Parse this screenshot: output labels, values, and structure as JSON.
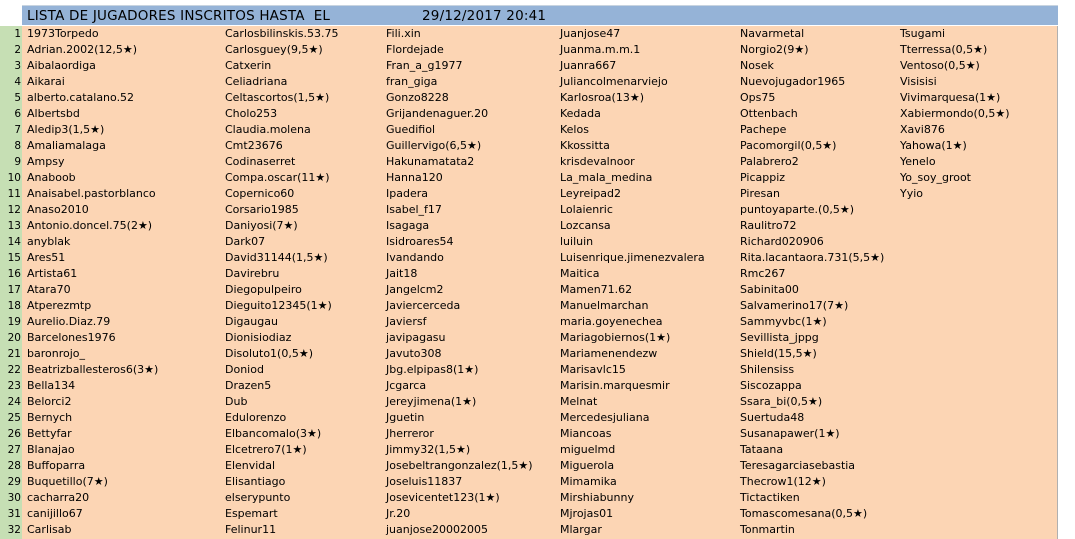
{
  "header": {
    "title": "LISTA DE JUGADORES INSCRITOS HASTA  EL",
    "date": "29/12/2017 20:41"
  },
  "row_numbers": [
    "1",
    "2",
    "3",
    "4",
    "5",
    "6",
    "7",
    "8",
    "9",
    "10",
    "11",
    "12",
    "13",
    "14",
    "15",
    "16",
    "17",
    "18",
    "19",
    "20",
    "21",
    "22",
    "23",
    "24",
    "25",
    "26",
    "27",
    "28",
    "29",
    "30",
    "31",
    "32"
  ],
  "columns": [
    [
      "1973Torpedo",
      "Adrian.2002(12,5★)",
      "Aibalaordiga",
      "Aikarai",
      "alberto.catalano.52",
      "Albertsbd",
      "Aledip3(1,5★)",
      "Amaliamalaga",
      "Ampsy",
      "Anaboob",
      "Anaisabel.pastorblanco",
      "Anaso2010",
      "Antonio.doncel.75(2★)",
      "anyblak",
      "Ares51",
      "Artista61",
      "Atara70",
      "Atperezmtp",
      "Aurelio.Diaz.79",
      "Barcelones1976",
      "baronrojo_",
      "Beatrizballesteros6(3★)",
      "Bella134",
      "Belorci2",
      "Bernych",
      "Bettyfar",
      "Blanajao",
      "Buffoparra",
      "Buquetillo(7★)",
      "cacharra20",
      "canijillo67",
      "Carlisab"
    ],
    [
      "Carlosbilinskis.53.75",
      "Carlosguey(9,5★)",
      "Catxerin",
      "Celiadriana",
      "Celtascortos(1,5★)",
      "Cholo253",
      "Claudia.molena",
      "Cmt23676",
      "Codinaserret",
      "Compa.oscar(11★)",
      "Copernico60",
      "Corsario1985",
      "Daniyosi(7★)",
      "Dark07",
      "David31144(1,5★)",
      "Davirebru",
      "Diegopulpeiro",
      "Dieguito12345(1★)",
      "Digaugau",
      "Dionisiodiaz",
      "Disoluto1(0,5★)",
      "Doniod",
      "Drazen5",
      "Dub",
      "Edulorenzo",
      "Elbancomalo(3★)",
      "Elcetrero7(1★)",
      "Elenvidal",
      "Elisantiago",
      "elserypunto",
      "Espemart",
      "Felinur11"
    ],
    [
      "Fili.xin",
      "Flordejade",
      "Fran_a_g1977",
      "fran_giga",
      "Gonzo8228",
      "Grijandenaguer.20",
      "Guedifiol",
      "Guillervigo(6,5★)",
      "Hakunamatata2",
      "Hanna120",
      "Ipadera",
      "Isabel_f17",
      "Isagaga",
      "Isidroares54",
      "Ivandando",
      "Jait18",
      "Jangelcm2",
      "Javiercerceda",
      "Javiersf",
      "javipagasu",
      "Javuto308",
      "Jbg.elpipas8(1★)",
      "Jcgarca",
      "Jereyjimena(1★)",
      "Jguetin",
      "Jherreror",
      "Jimmy32(1,5★)",
      "Josebeltrangonzalez(1,5★)",
      "Joseluis11837",
      "Josevicentet123(1★)",
      "Jr.20",
      "juanjose20002005"
    ],
    [
      "Juanjose47",
      "Juanma.m.m.1",
      "Juanra667",
      "Juliancolmenarviejo",
      "Karlosroa(13★)",
      "Kedada",
      "Kelos",
      "Kkossitta",
      "krisdevalnoor",
      "La_mala_medina",
      "Leyreipad2",
      "Lolaienric",
      "Lozcansa",
      "luiluin",
      "Luisenrique.jimenezvalera",
      "Maitica",
      "Mamen71.62",
      "Manuelmarchan",
      "maria.goyenechea",
      "Mariagobiernos(1★)",
      "Mariamenendezw",
      "Marisavlc15",
      "Marisin.marquesmir",
      "Melnat",
      "Mercedesjuliana",
      "Miancoas",
      "miguelmd",
      "Miguerola",
      "Mimamika",
      "Mirshiabunny",
      "Mjrojas01",
      "Mlargar"
    ],
    [
      "Navarmetal",
      "Norgio2(9★)",
      "Nosek",
      "Nuevojugador1965",
      "Ops75",
      "Ottenbach",
      "Pachepe",
      "Pacomorgil(0,5★)",
      "Palabrero2",
      "Picappiz",
      "Piresan",
      "puntoyaparte.(0,5★)",
      "Raulitro72",
      "Richard020906",
      "Rita.lacantaora.731(5,5★)",
      "Rmc267",
      "Sabinita00",
      "Salvamerino17(7★)",
      "Sammyvbc(1★)",
      "Sevillista_jppg",
      "Shield(15,5★)",
      "Shilensiss",
      "Siscozappa",
      "Ssara_bi(0,5★)",
      "Suertuda48",
      "Susanapawer(1★)",
      "Tataana",
      "Teresagarciasebastia",
      "Thecrow1(12★)",
      "Tictactiken",
      "Tomascomesana(0,5★)",
      "Tonmartin"
    ],
    [
      "Tsugami",
      "Tterressa(0,5★)",
      "Ventoso(0,5★)",
      "Visisisi",
      "Vivimarquesa(1★)",
      "Xabiermondo(0,5★)",
      "Xavi876",
      "Yahowa(1★)",
      "Yenelo",
      "Yo_soy_groot",
      "Yyio"
    ]
  ]
}
